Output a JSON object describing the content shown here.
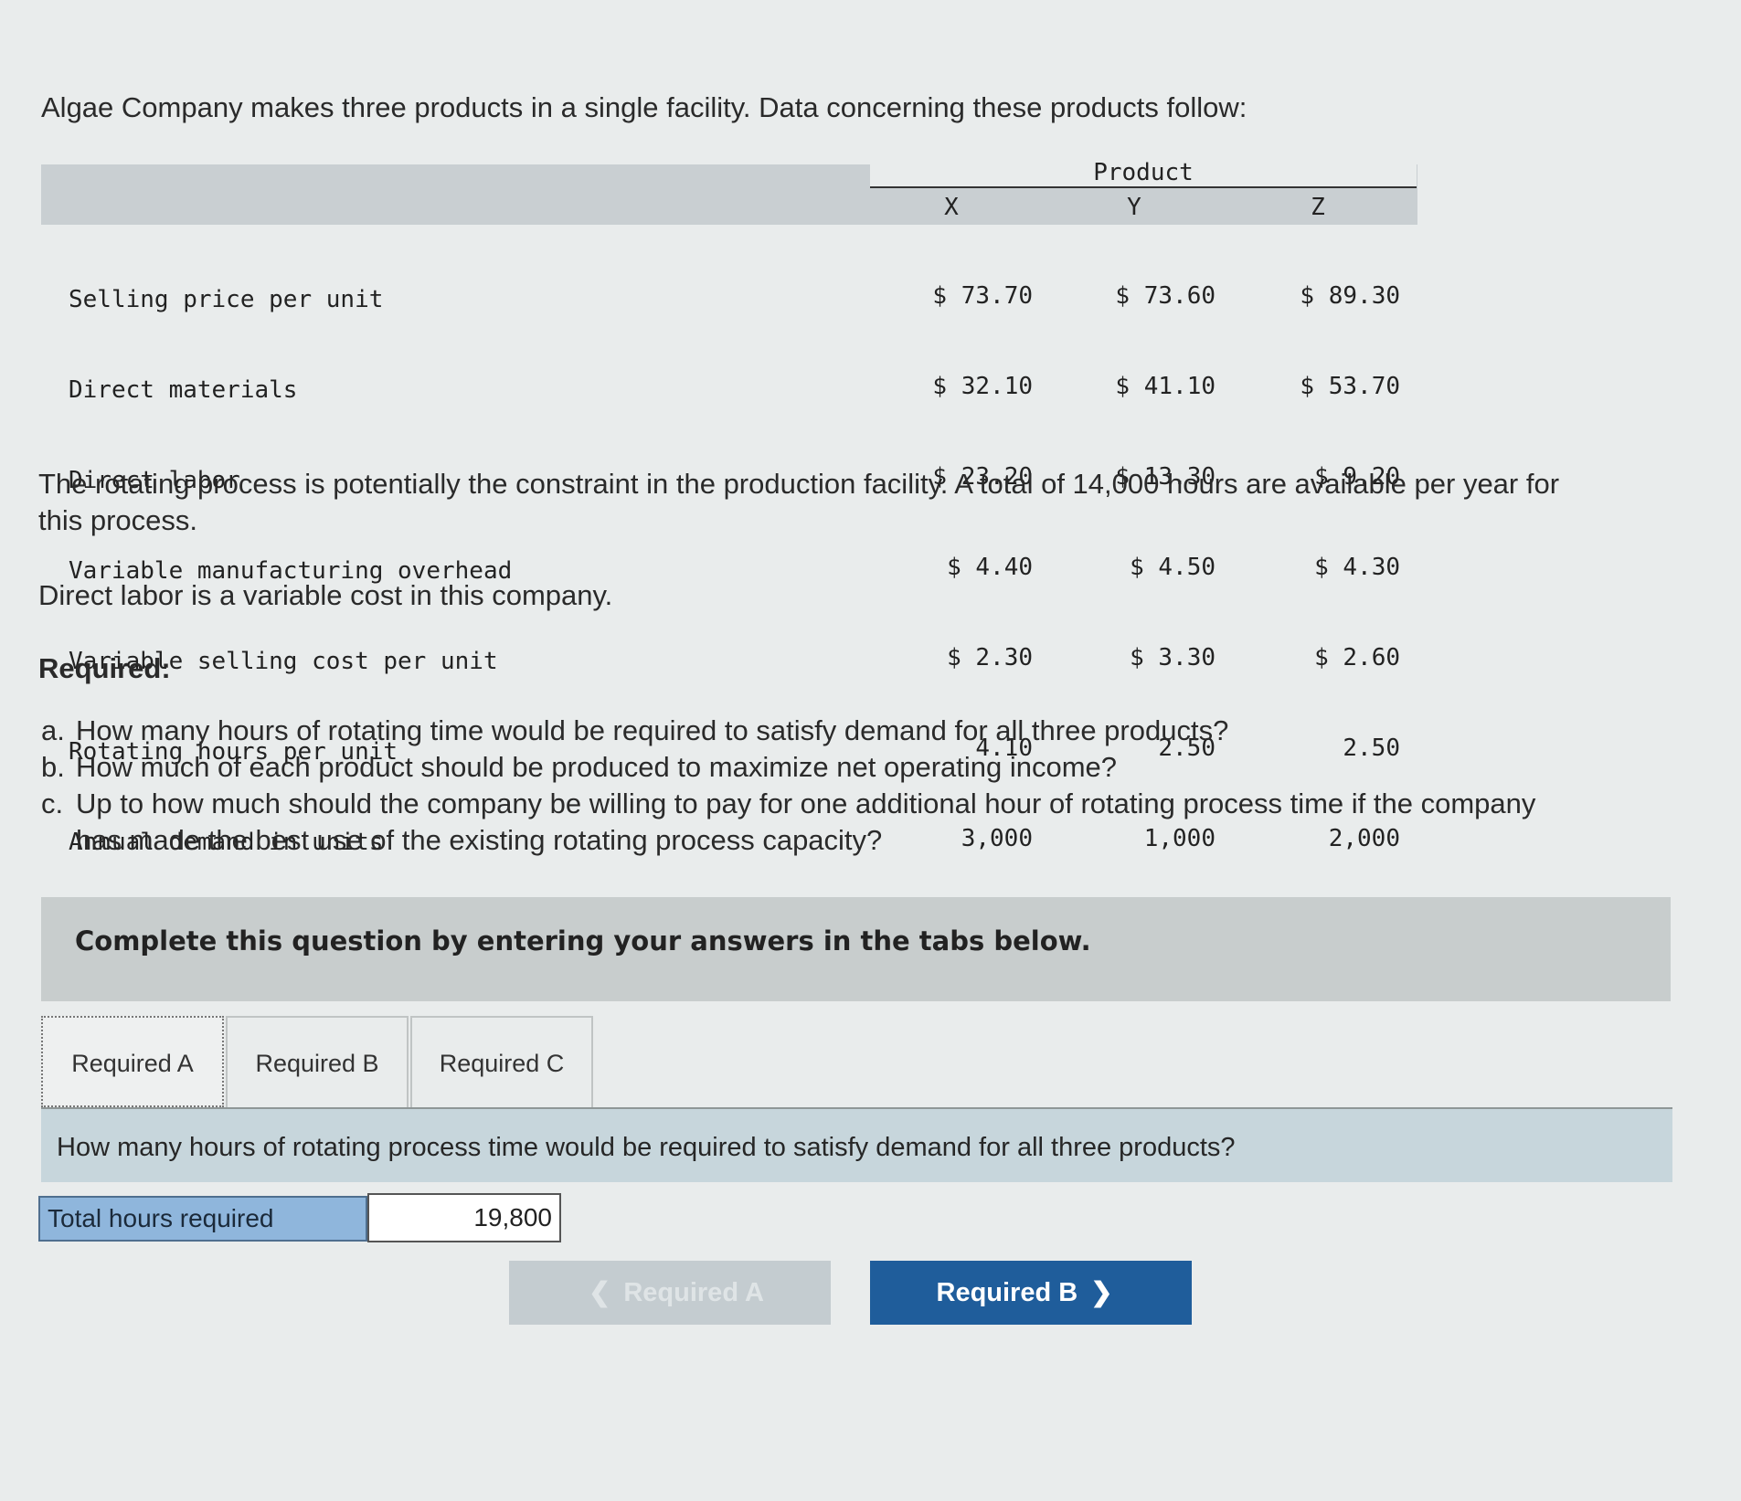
{
  "intro": "Algae Company makes three products in a single facility. Data concerning these products follow:",
  "table": {
    "group_header": "Product",
    "columns": [
      "X",
      "Y",
      "Z"
    ],
    "rows": [
      {
        "label": "Selling price per unit",
        "values": [
          "$ 73.70",
          "$ 73.60",
          "$ 89.30"
        ]
      },
      {
        "label": "Direct materials",
        "values": [
          "$ 32.10",
          "$ 41.10",
          "$ 53.70"
        ]
      },
      {
        "label": "Direct labor",
        "values": [
          "$ 23.20",
          "$ 13.30",
          "$ 9.20"
        ]
      },
      {
        "label": "Variable manufacturing overhead",
        "values": [
          "$ 4.40",
          "$ 4.50",
          "$ 4.30"
        ]
      },
      {
        "label": "Variable selling cost per unit",
        "values": [
          "$ 2.30",
          "$ 3.30",
          "$ 2.60"
        ]
      },
      {
        "label": "Rotating hours per unit",
        "values": [
          "4.10",
          "2.50",
          "2.50"
        ]
      },
      {
        "label": "Annual demand in units",
        "values": [
          "3,000",
          "1,000",
          "2,000"
        ]
      }
    ]
  },
  "constraint_text": "The rotating process is potentially the constraint in the production facility. A total of 14,000 hours are available per year for this process.",
  "labor_text": "Direct labor is a variable cost in this company.",
  "required_heading": "Required:",
  "questions": [
    {
      "letter": "a.",
      "text": "How many hours of rotating time would be required to satisfy demand for all three products?"
    },
    {
      "letter": "b.",
      "text": "How much of each product should be produced to maximize net operating income?"
    },
    {
      "letter": "c.",
      "text": "Up to how much should the company be willing to pay for one additional hour of rotating process time if the company has made the best use of the existing rotating process capacity?"
    }
  ],
  "instructions": "Complete this question by entering your answers in the tabs below.",
  "tabs": [
    {
      "label": "Required A",
      "active": true
    },
    {
      "label": "Required B",
      "active": false
    },
    {
      "label": "Required C",
      "active": false
    }
  ],
  "active_question": "How many hours of rotating process time would be required to satisfy demand for all three products?",
  "answer": {
    "label": "Total hours required",
    "value": "19,800"
  },
  "nav": {
    "prev_label": "Required A",
    "next_label": "Required B"
  },
  "icons": {
    "prev": "chevron-left-icon",
    "next": "chevron-right-icon"
  }
}
